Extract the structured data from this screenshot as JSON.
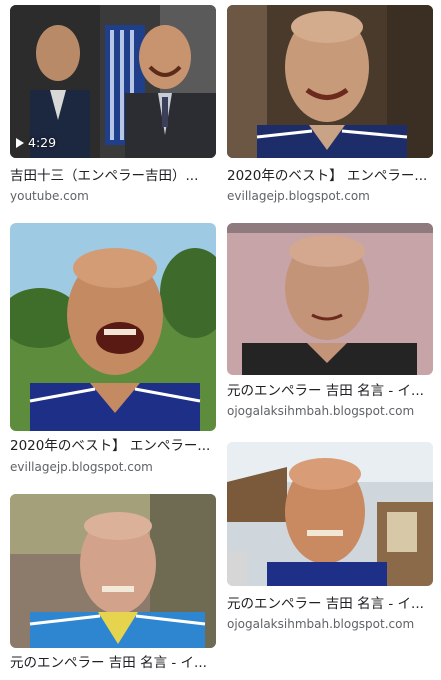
{
  "results": [
    {
      "title": "吉田十三（エンペラー吉田）...",
      "source": "youtube.com",
      "duration": "4:29"
    },
    {
      "title": "2020年のベスト】 エンペラー...",
      "source": "evillagejp.blogspot.com"
    },
    {
      "title": "2020年のベスト】 エンペラー...",
      "source": "evillagejp.blogspot.com"
    },
    {
      "title": "元のエンペラー 吉田 名言 - イ...",
      "source": "ojogalaksihmbah.blogspot.com"
    },
    {
      "title": "元のエンペラー 吉田 名言 - イ...",
      "source": "ojogalaksihmbah.blogspot.com"
    },
    {
      "title": "元のエンペラー 吉田 名言 - イ...",
      "source": ""
    }
  ]
}
